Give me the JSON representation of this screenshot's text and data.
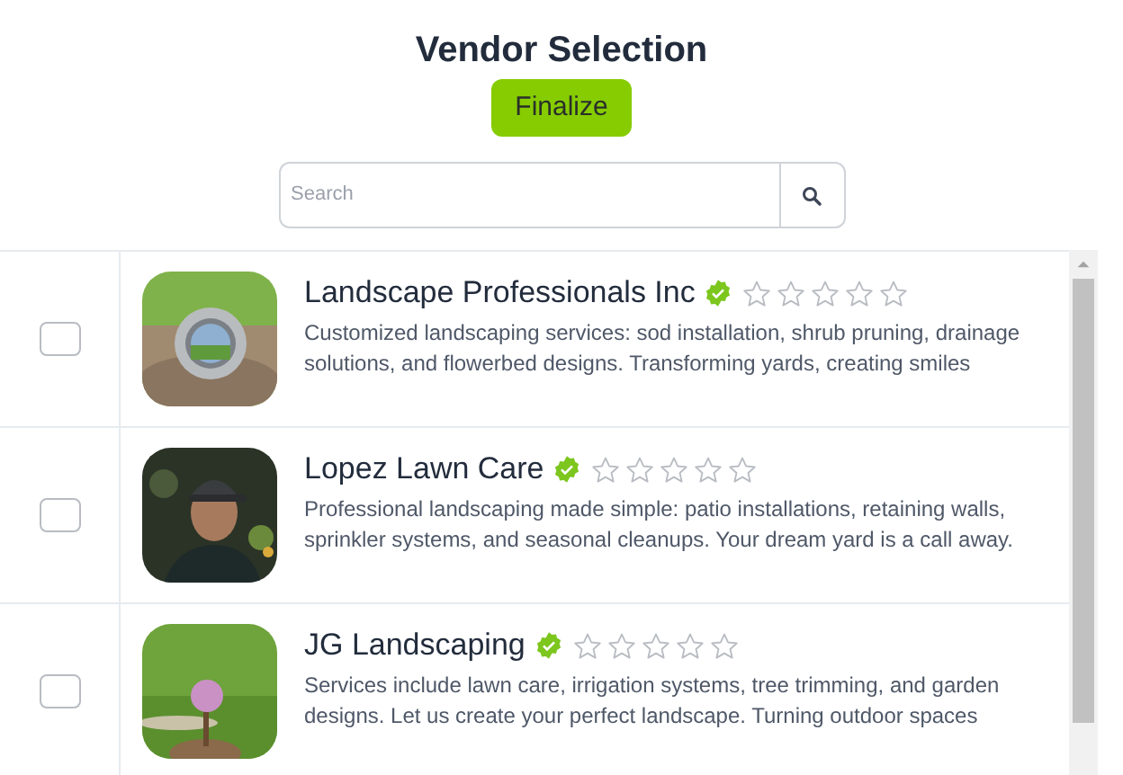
{
  "title": "Vendor Selection",
  "finalize_button": "Finalize",
  "search": {
    "placeholder": "Search"
  },
  "vendors": [
    {
      "name": "Landscape Professionals Inc",
      "verified": true,
      "stars": 0,
      "checked": false,
      "description": "Customized landscaping services: sod installation, shrub pruning, drainage solutions, and flowerbed designs. Transforming yards, creating smiles"
    },
    {
      "name": "Lopez Lawn Care",
      "verified": true,
      "stars": 0,
      "checked": false,
      "description": "Professional landscaping made simple: patio installations, retaining walls, sprinkler systems, and seasonal cleanups. Your dream yard is a call away."
    },
    {
      "name": "JG Landscaping",
      "verified": true,
      "stars": 0,
      "checked": false,
      "description": "Services include lawn care, irrigation systems, tree trimming, and garden designs. Let us create your perfect landscape. Turning outdoor spaces"
    }
  ]
}
